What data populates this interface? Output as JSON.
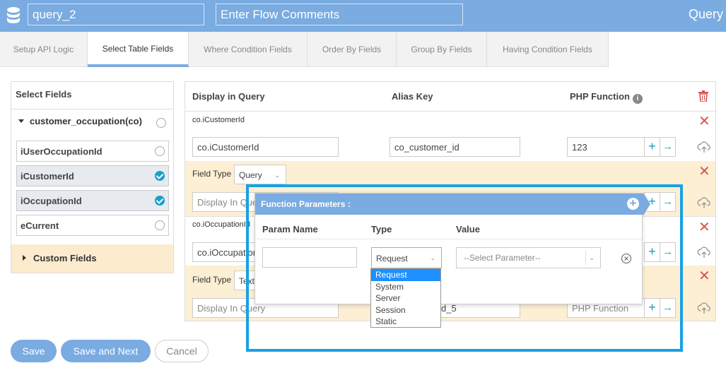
{
  "header": {
    "query_name": "query_2",
    "flow_comments_placeholder": "Enter Flow Comments",
    "title": "Query"
  },
  "tabs": [
    {
      "label": "Setup API Logic",
      "active": false
    },
    {
      "label": "Select Table Fields",
      "active": true
    },
    {
      "label": "Where Condition Fields",
      "active": false
    },
    {
      "label": "Order By Fields",
      "active": false
    },
    {
      "label": "Group By Fields",
      "active": false
    },
    {
      "label": "Having Condition Fields",
      "active": false
    }
  ],
  "select_fields": {
    "title": "Select Fields",
    "table_name": "customer_occupation(co)",
    "fields": [
      {
        "label": "iUserOccupationId",
        "checked": false
      },
      {
        "label": "iCustomerId",
        "checked": true
      },
      {
        "label": "iOccupationId",
        "checked": true
      },
      {
        "label": "eCurrent",
        "checked": false
      }
    ],
    "custom_fields_label": "Custom Fields"
  },
  "columns": {
    "display": "Display in Query",
    "alias": "Alias Key",
    "php": "PHP Function"
  },
  "rows": [
    {
      "label": "co.iCustomerId",
      "display_value": "co.iCustomerId",
      "alias_value": "co_customer_id",
      "php_value": "123",
      "field_type_label": "Field Type",
      "field_type_value": "Query",
      "display_placeholder": "Display In Query"
    },
    {
      "label": "co.iOccupationId",
      "display_value": "co.iOccupationId",
      "field_type_label": "Field Type",
      "field_type_value": "Text",
      "display_placeholder": "Display In Query",
      "alias_partial": "d_5",
      "php_placeholder": "PHP Function"
    }
  ],
  "popup": {
    "title": "Function Parameters :",
    "col_param_name": "Param Name",
    "col_type": "Type",
    "col_value": "Value",
    "type_selected": "Request",
    "value_placeholder": "--Select Parameter--",
    "type_options": [
      "Request",
      "System",
      "Server",
      "Session",
      "Static"
    ]
  },
  "buttons": {
    "save": "Save",
    "save_next": "Save and Next",
    "cancel": "Cancel"
  },
  "colors": {
    "accent": "#7aabe1",
    "highlight": "#19a1e3",
    "beige": "#fdefd3",
    "danger": "#d9534f"
  }
}
